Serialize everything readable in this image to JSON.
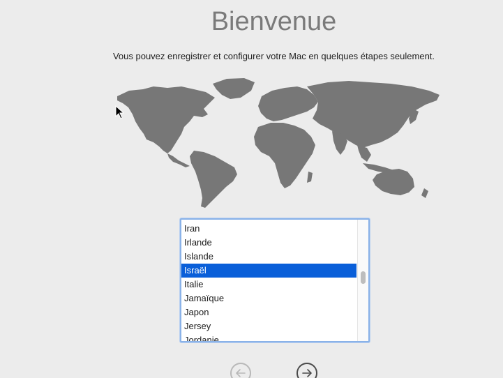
{
  "title": "Bienvenue",
  "subtitle": "Vous pouvez enregistrer et configurer votre Mac en quelques étapes seulement.",
  "country_list": {
    "items": [
      {
        "label": "Iran",
        "selected": false
      },
      {
        "label": "Irlande",
        "selected": false
      },
      {
        "label": "Islande",
        "selected": false
      },
      {
        "label": "Israël",
        "selected": true
      },
      {
        "label": "Italie",
        "selected": false
      },
      {
        "label": "Jamaïque",
        "selected": false
      },
      {
        "label": "Japon",
        "selected": false
      },
      {
        "label": "Jersey",
        "selected": false
      },
      {
        "label": "Jordanie",
        "selected": false
      }
    ],
    "selected_color": "#0a5fd9"
  },
  "navigation": {
    "back_icon": "arrow-left-icon",
    "next_icon": "arrow-right-icon"
  },
  "colors": {
    "background": "#ececec",
    "map": "#777777",
    "focus_ring": "#8ab2e8"
  }
}
